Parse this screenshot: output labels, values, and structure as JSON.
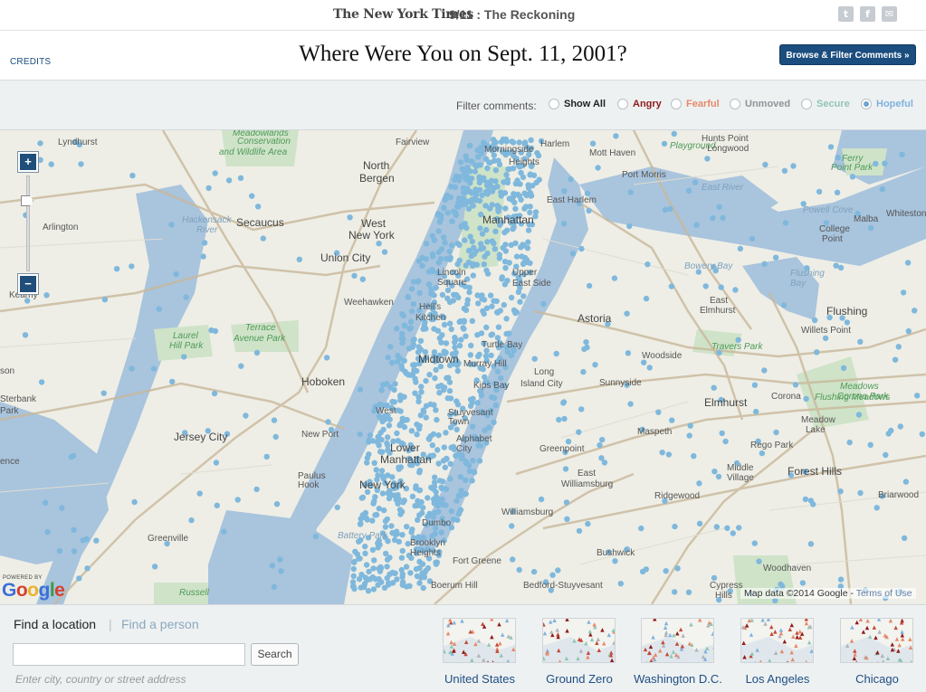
{
  "topbar": {
    "logo": "The New York Times",
    "section": "9/11 : The Reckoning",
    "share_icons": [
      "twitter-icon",
      "facebook-icon",
      "email-icon"
    ]
  },
  "header": {
    "credits": "CREDITS",
    "title": "Where Were You on Sept. 11, 2001?",
    "browse_button": "Browse & Filter Comments »"
  },
  "filter": {
    "label": "Filter comments:",
    "options": [
      {
        "label": "Show All",
        "color": "#222222",
        "bold": true,
        "checked": false
      },
      {
        "label": "Angry",
        "color": "#8e1b1b",
        "bold": true,
        "checked": false
      },
      {
        "label": "Fearful",
        "color": "#e5896a",
        "bold": true,
        "checked": false
      },
      {
        "label": "Unmoved",
        "color": "#8f9499",
        "bold": true,
        "checked": false
      },
      {
        "label": "Secure",
        "color": "#8fc6b3",
        "bold": true,
        "checked": false
      },
      {
        "label": "Hopeful",
        "color": "#7fb2dd",
        "bold": true,
        "checked": true
      }
    ]
  },
  "map": {
    "zoom_in": "+",
    "zoom_out": "−",
    "powered_by": "POWERED BY",
    "google": "Google",
    "attribution": "Map data ©2014 Google -",
    "terms": "Terms of Use",
    "marker_color": "#7fb8dc",
    "places": [
      "Lyndhurst",
      "Meadowlands",
      "Conservation",
      "and Wildlife Area",
      "Fairview",
      "North",
      "Bergen",
      "Morningside",
      "Heights",
      "Harlem",
      "Mott Haven",
      "Port Morris",
      "Playground",
      "Hunts Point",
      "- Longwood",
      "Ferry",
      "Point Park",
      "Secaucus",
      "Hackensack",
      "River",
      "West",
      "New York",
      "Union City",
      "Manhattan",
      "East Harlem",
      "East River",
      "Powell Cove",
      "College",
      "Point",
      "Malba",
      "Whitestone",
      "Arlington",
      "Kearny",
      "Weehawken",
      "Lincoln",
      "Square",
      "Upper",
      "East Side",
      "Hell's",
      "Kitchen",
      "Astoria",
      "Bowery Bay",
      "Flushing",
      "Bay",
      "East",
      "Elmhurst",
      "Laurel",
      "Hill Park",
      "Terrace",
      "Avenue Park",
      "Hoboken",
      "Midtown",
      "Turtle Bay",
      "Murray Hill",
      "Kips Bay",
      "Long",
      "Island City",
      "Sunnyside",
      "Woodside",
      "Travers Park",
      "Willets Point",
      "Elmhurst",
      "Corona",
      "Flushing",
      "Meadows",
      "Corona Park",
      "Jersey City",
      "New Port",
      "West",
      "Stuyvesant",
      "Town",
      "Alphabet",
      "City",
      "Lower",
      "Manhattan",
      "Greenpoint",
      "Maspeth",
      "Rego Park",
      "Forest Hills",
      "Paulus",
      "Hook",
      "New York",
      "East",
      "Williamsburg",
      "Middle",
      "Village",
      "Ridgewood",
      "Briarwood",
      "Williamsburg",
      "Greenville",
      "Dumbo",
      "Battery Park",
      "Brooklyn",
      "Heights",
      "Fort Greene",
      "Bushwick",
      "Bedford-Stuyvesant",
      "Boerum Hill",
      "Cypress",
      "Hills",
      "Woodhaven",
      "Russell",
      "Sterbank",
      "Park",
      "son",
      "ence",
      "Meadow",
      "Lake",
      "Flushing Meadows"
    ]
  },
  "bottom": {
    "tab_location": "Find a location",
    "tab_separator": "|",
    "tab_person": "Find a person",
    "search_button": "Search",
    "input_value": "",
    "input_hint": "Enter city, country or street address",
    "thumbnails": [
      "United States",
      "Ground Zero",
      "Washington D.C.",
      "Los Angeles",
      "Chicago"
    ]
  }
}
